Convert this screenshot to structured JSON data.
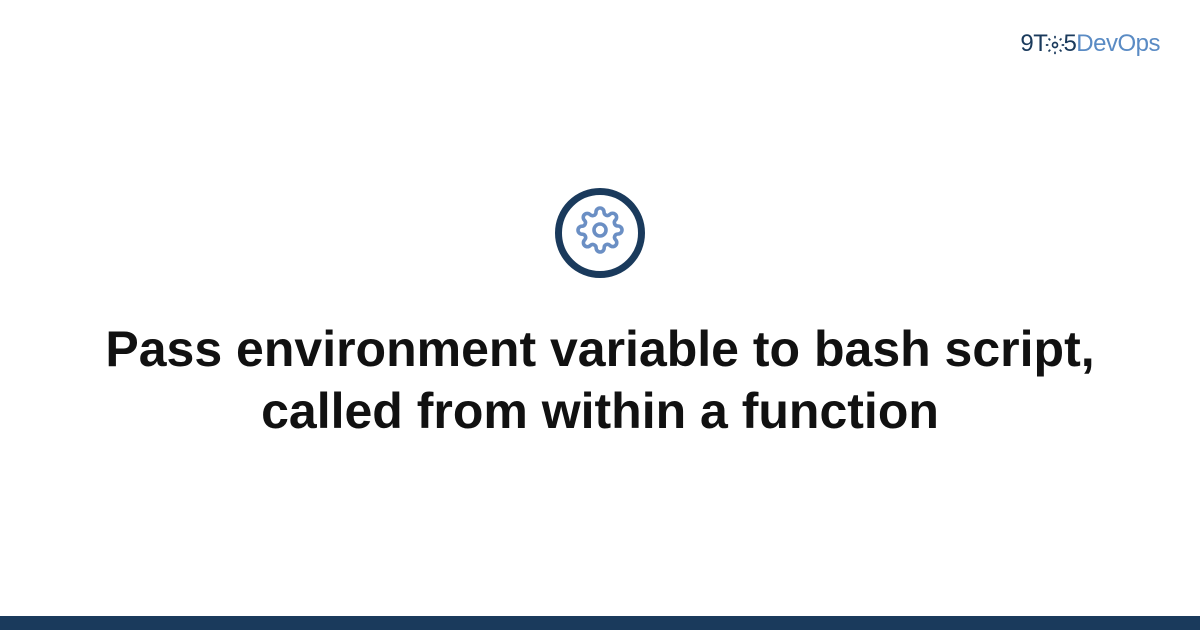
{
  "logo": {
    "part1": "9T",
    "part2": "5",
    "part3": "DevOps"
  },
  "main": {
    "title": "Pass environment variable to bash script, called from within a function"
  },
  "colors": {
    "brand_dark": "#1a3a5c",
    "brand_light": "#5a8bc4"
  },
  "icons": {
    "main": "gear-icon",
    "logo": "gear-icon-small"
  }
}
